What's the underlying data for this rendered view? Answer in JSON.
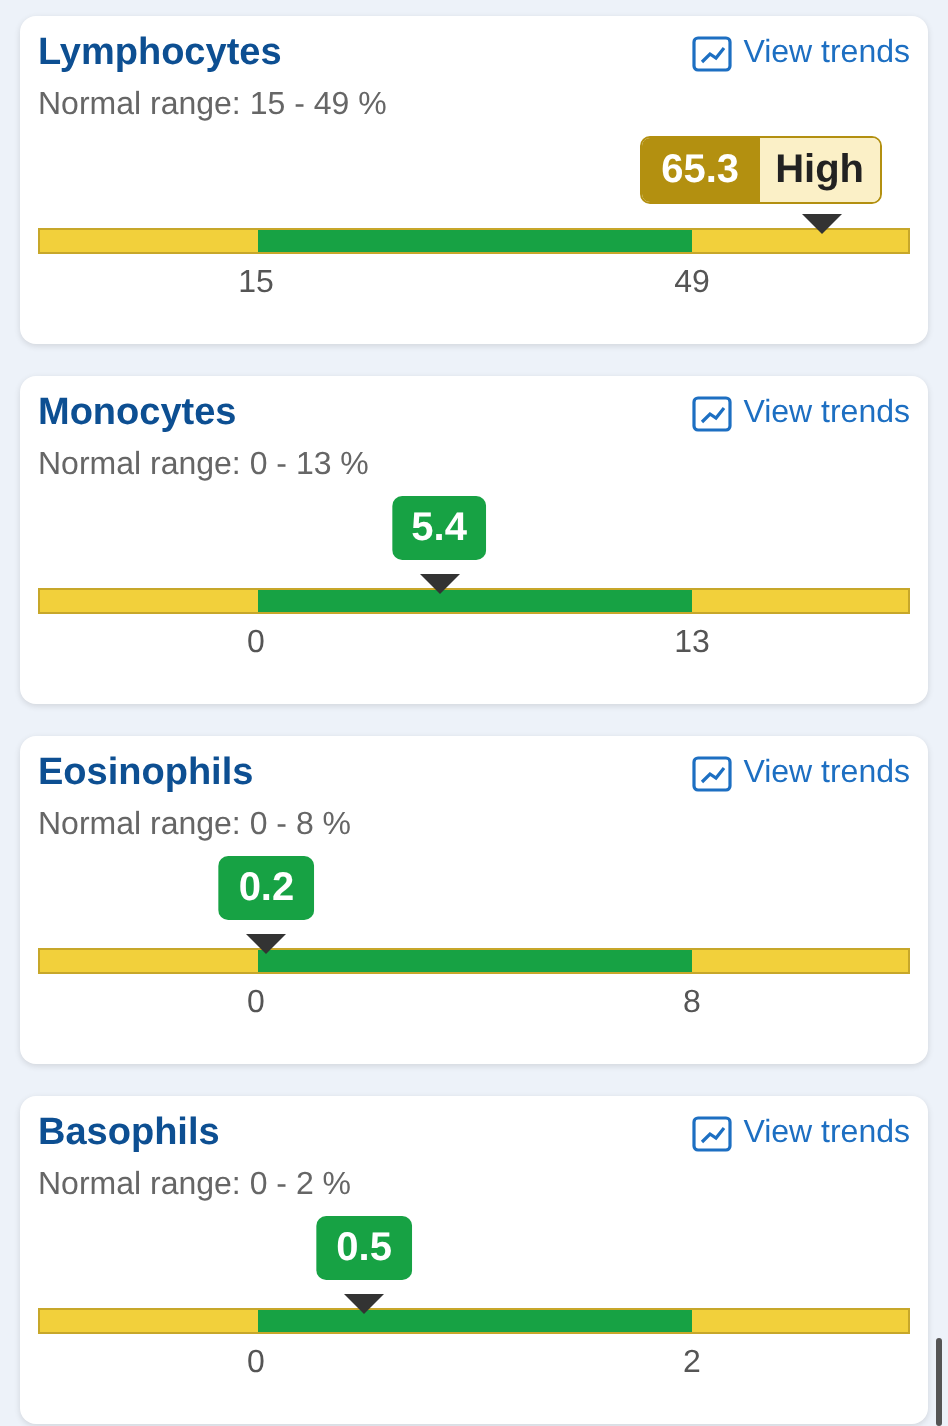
{
  "results": [
    {
      "name": "Lymphocytes",
      "link": "View trends",
      "range": "Normal range: 15 - 49 %",
      "value": "65.3",
      "kind": "high",
      "flag": "High",
      "level": 0.9,
      "ticks": [
        "15",
        "49"
      ]
    },
    {
      "name": "Monocytes",
      "link": "View trends",
      "range": "Normal range: 0 - 13 %",
      "value": "5.4",
      "kind": "normal",
      "level": 0.46,
      "ticks": [
        "0",
        "13"
      ]
    },
    {
      "name": "Eosinophils",
      "link": "View trends",
      "range": "Normal range: 0 - 8 %",
      "value": "0.2",
      "kind": "normal",
      "level": 0.262,
      "ticks": [
        "0",
        "8"
      ]
    },
    {
      "name": "Basophils",
      "link": "View trends",
      "range": "Normal range: 0 - 2 %",
      "value": "0.5",
      "kind": "normal",
      "level": 0.374,
      "ticks": [
        "0",
        "2"
      ]
    }
  ]
}
